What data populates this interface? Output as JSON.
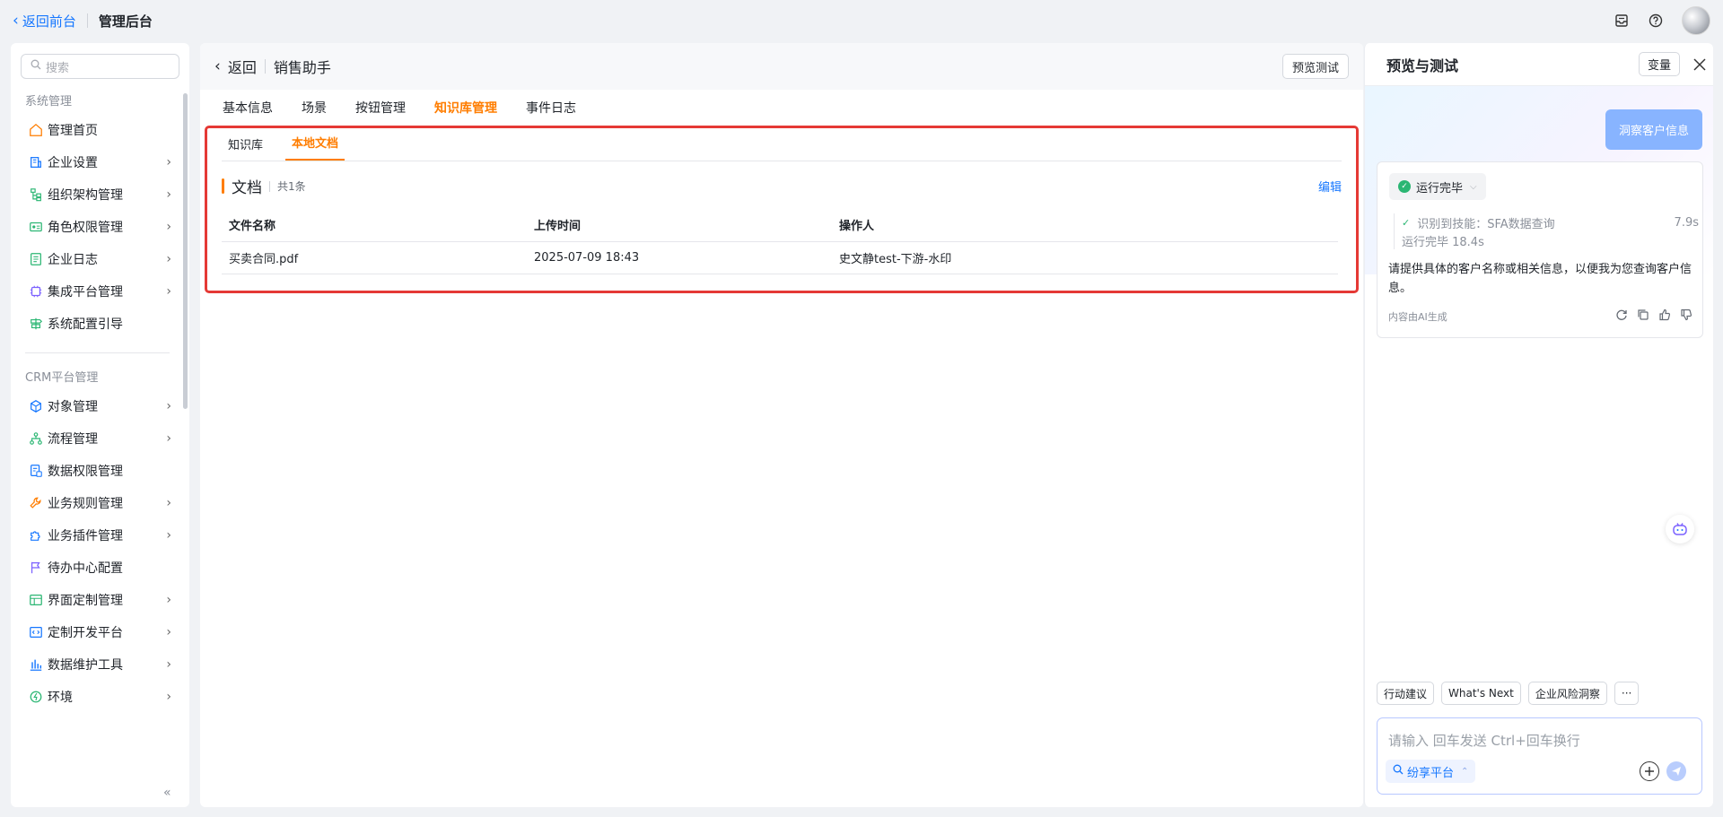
{
  "topbar": {
    "back_label": "返回前台",
    "title": "管理后台",
    "icons": [
      "inbox-icon",
      "help-icon"
    ]
  },
  "sidebar": {
    "search_placeholder": "搜索",
    "section1_title": "系统管理",
    "section1_items": [
      {
        "label": "管理首页",
        "icon": "home-icon",
        "has_arrow": false,
        "color": "#ff7d00"
      },
      {
        "label": "企业设置",
        "icon": "building-icon",
        "has_arrow": true,
        "color": "#1677ff"
      },
      {
        "label": "组织架构管理",
        "icon": "org-tree-icon",
        "has_arrow": true,
        "color": "#2bb673"
      },
      {
        "label": "角色权限管理",
        "icon": "id-card-icon",
        "has_arrow": true,
        "color": "#2bb673"
      },
      {
        "label": "企业日志",
        "icon": "log-icon",
        "has_arrow": true,
        "color": "#2bb673"
      },
      {
        "label": "集成平台管理",
        "icon": "chip-icon",
        "has_arrow": true,
        "color": "#7b61ff"
      },
      {
        "label": "系统配置引导",
        "icon": "signpost-icon",
        "has_arrow": false,
        "color": "#2bb673"
      }
    ],
    "section2_title": "CRM平台管理",
    "section2_items": [
      {
        "label": "对象管理",
        "icon": "cube-icon",
        "has_arrow": true,
        "color": "#1677ff"
      },
      {
        "label": "流程管理",
        "icon": "flow-icon",
        "has_arrow": true,
        "color": "#2bb673"
      },
      {
        "label": "数据权限管理",
        "icon": "data-lock-icon",
        "has_arrow": false,
        "color": "#1677ff"
      },
      {
        "label": "业务规则管理",
        "icon": "wrench-icon",
        "has_arrow": true,
        "color": "#ff7d00"
      },
      {
        "label": "业务插件管理",
        "icon": "puzzle-icon",
        "has_arrow": true,
        "color": "#1677ff"
      },
      {
        "label": "待办中心配置",
        "icon": "flag-icon",
        "has_arrow": false,
        "color": "#7b61ff"
      },
      {
        "label": "界面定制管理",
        "icon": "layout-icon",
        "has_arrow": true,
        "color": "#2bb673"
      },
      {
        "label": "定制开发平台",
        "icon": "code-icon",
        "has_arrow": true,
        "color": "#1677ff"
      },
      {
        "label": "数据维护工具",
        "icon": "bar-chart-icon",
        "has_arrow": true,
        "color": "#1677ff"
      },
      {
        "label": "环境",
        "icon": "environment-icon",
        "has_arrow": true,
        "color": "#2bb673"
      }
    ]
  },
  "main": {
    "back_label": "返回",
    "page_title": "销售助手",
    "preview_button": "预览测试",
    "tabs": [
      "基本信息",
      "场景",
      "按钮管理",
      "知识库管理",
      "事件日志"
    ],
    "active_tab": 3,
    "subtabs": [
      "知识库",
      "本地文档"
    ],
    "active_subtab": 1,
    "doc_title": "文档",
    "doc_count": "共1条",
    "edit_label": "编辑",
    "columns": [
      "文件名称",
      "上传时间",
      "操作人"
    ],
    "rows": [
      [
        "买卖合同.pdf",
        "2025-07-09 18:43",
        "史文静test-下游-水印"
      ]
    ],
    "highlight_color": "#e53935"
  },
  "right_panel": {
    "title": "预览与测试",
    "var_button": "变量",
    "user_message": "洞察客户信息",
    "status": "运行完毕",
    "skill_text": "识别到技能：SFA数据查询",
    "skill_time": "7.9s",
    "run_text": "运行完毕 18.4s",
    "reply": "请提供具体的客户名称或相关信息，以便我为您查询客户信息。",
    "ai_note": "内容由AI生成",
    "chips": [
      "行动建议",
      "What's Next",
      "企业风险洞察",
      "···"
    ],
    "input_placeholder": "请输入 回车发送 Ctrl+回车换行",
    "platform_label": "纷享平台"
  }
}
